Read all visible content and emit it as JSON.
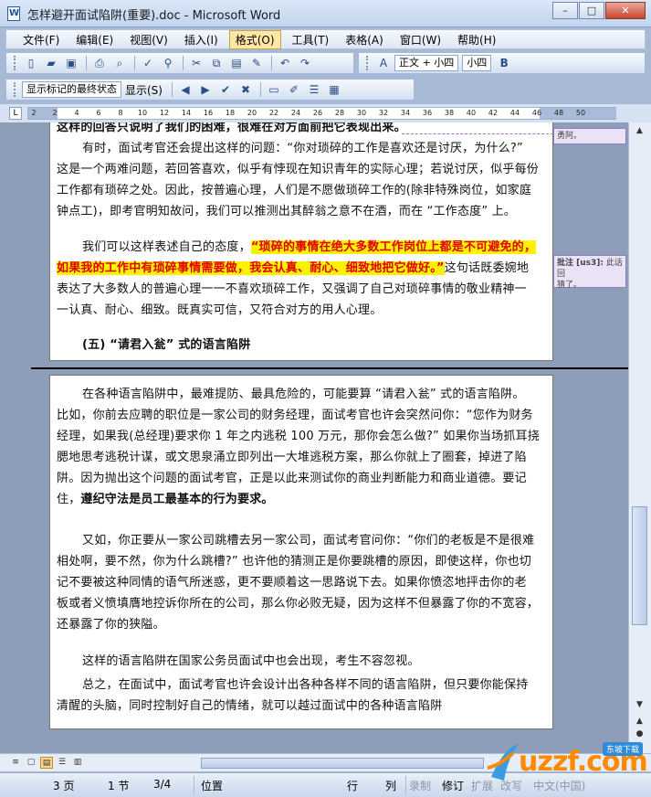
{
  "window": {
    "title": "怎样避开面试陷阱(重要).doc - Microsoft Word",
    "buttons": {
      "minimize": "–",
      "maximize": "□",
      "close": "✕"
    }
  },
  "menu": {
    "items": [
      "文件(F)",
      "编辑(E)",
      "视图(V)",
      "插入(I)",
      "格式(O)",
      "工具(T)",
      "表格(A)",
      "窗口(W)",
      "帮助(H)"
    ],
    "active_index": 4
  },
  "formatting": {
    "style": "正文 + 小四",
    "font_size": "小四",
    "bold_label": "B",
    "markup_view": "显示标记的最终状态",
    "show_label": "显示(S)"
  },
  "ruler": {
    "ticks": [
      "2",
      "2",
      "4",
      "6",
      "8",
      "10",
      "12",
      "14",
      "16",
      "18",
      "20",
      "22",
      "24",
      "26",
      "28",
      "30",
      "32",
      "34",
      "36",
      "38",
      "40",
      "42",
      "44",
      "46",
      "48",
      "50"
    ]
  },
  "document": {
    "page1": {
      "partial_top": "这样的回答只说明了我们的困难，很难在对方面前把它表现出来。",
      "para1": [
        "有时，面试考官还会提出这样的问题：“你对琐碎的工作是喜欢还是讨厌，为什么?”",
        "这是一个两难问题，若回答喜欢，似乎有悖现在知识青年的实际心理；若说讨厌，似乎每份",
        "工作都有琐碎之处。因此，按普遍心理，人们是不愿做琐碎工作的(除非特殊岗位，如家庭",
        "钟点工)，即考官明知故问，我们可以推测出其醉翁之意不在酒，而在 “工作态度” 上。"
      ],
      "para2_lead": "我们可以这样表述自己的态度，",
      "para2_highlight_1": "“琐碎的事情在绝大多数工作岗位上都是不可避免的，",
      "para2_highlight_2": "如果我的工作中有琐碎事情需要做，我会认真、耐心、细致地把它做好。”",
      "para2_rest_1": "这句话既委婉地",
      "para2_rest_2": "表达了大多数人的普遍心理一一不喜欢琐碎工作，又强调了自己对琐碎事情的敬业精神一",
      "para2_rest_3": "一认真、耐心、细致。既真实可信，又符合对方的用人心理。",
      "heading": "(五) “请君入瓮” 式的语言陷阱"
    },
    "page2": {
      "para1": [
        "在各种语言陷阱中，最难提防、最具危险的，可能要算 “请君入瓮” 式的语言陷阱。",
        "比如，你前去应聘的职位是一家公司的财务经理，面试考官也许会突然问你：“您作为财务",
        "经理，如果我(总经理)要求你 1 年之内逃税 100 万元，那你会怎么做?” 如果你当场抓耳挠",
        "腮地思考逃税计谋，或文思泉涌立即列出一大堆逃税方案，那么你就上了圈套，掉进了陷",
        "阱。因为抛出这个问题的面试考官，正是以此来测试你的商业判断能力和商业道德。要记",
        "住，"
      ],
      "para1_bold_end": "遵纪守法是员工最基本的行为要求。",
      "para2": [
        "又如，你正要从一家公司跳槽去另一家公司，面试考官问你：“你们的老板是不是很难",
        "相处啊，要不然，你为什么跳槽?” 也许他的猜测正是你要跳槽的原因，即使这样，你也切",
        "记不要被这种同情的语气所迷惑，更不要顺着这一思路说下去。如果你愤恣地抨击你的老",
        "板或者义愤填膺地控诉你所在的公司，那么你必败无疑，因为这样不但暴露了你的不宽容，",
        "还暴露了你的狭隘。"
      ],
      "para3": "这样的语言陷阱在国家公务员面试中也会出现，考生不容忽视。",
      "para4": [
        "总之，在面试中，面试考官也许会设计出各种各样不同的语言陷阱，但只要你能保持",
        "清醒的头脑，同时控制好自己的情绪，就可以越过面试中的各种语言陷阱"
      ]
    }
  },
  "comments": {
    "balloon1": "勇阿。",
    "balloon2_label": "批注 [us3]:",
    "balloon2_text": "此话回",
    "balloon2_text2": "猜了。"
  },
  "status": {
    "page": "3 页",
    "section": "1 节",
    "count": "3/4",
    "position": "位置",
    "line": "行",
    "col": "列",
    "rec": "录制",
    "trk": "修订",
    "ext": "扩展",
    "ovr": "改写",
    "lang": "中文(中国)"
  },
  "logo": {
    "text": "uzzf.com",
    "badge": "东坡下载"
  },
  "colors": {
    "highlight": "#fff200",
    "highlight_text": "#e00000",
    "comment_bg": "#eae3f5"
  }
}
